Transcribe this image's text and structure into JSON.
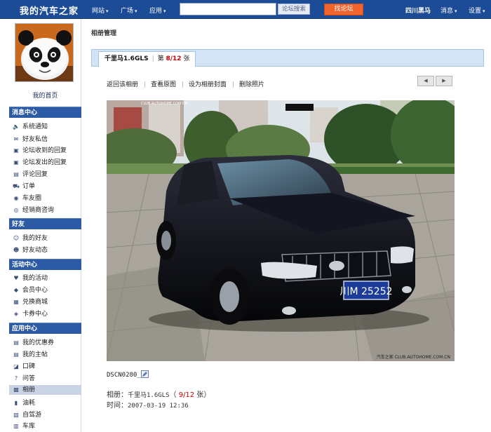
{
  "topbar": {
    "logo": "我的汽车之家",
    "nav": [
      {
        "label": "网站",
        "caret": "▾"
      },
      {
        "label": "广场",
        "caret": "▾"
      },
      {
        "label": "应用",
        "caret": "▾"
      }
    ],
    "search": {
      "value": "",
      "placeholder": ""
    },
    "search_button": "论坛搜索",
    "forum_button": "找论坛",
    "user": "四川黑马",
    "messages": "消息",
    "settings": "设置",
    "caret": "▾",
    "bg": "#1d4c96"
  },
  "sidebar": {
    "home_link": "我的首页",
    "sections": [
      {
        "title": "消息中心",
        "items": [
          {
            "label": "系统通知",
            "icon": "speaker-icon",
            "glyph": "🔈"
          },
          {
            "label": "好友私信",
            "icon": "mail-icon",
            "glyph": "✉"
          },
          {
            "label": "论坛收到的回复",
            "icon": "reply-in-icon",
            "glyph": "▣"
          },
          {
            "label": "论坛发出的回复",
            "icon": "reply-out-icon",
            "glyph": "▣"
          },
          {
            "label": "评论回复",
            "icon": "comment-icon",
            "glyph": "▤"
          },
          {
            "label": "订单",
            "icon": "cart-icon",
            "glyph": "⛟"
          },
          {
            "label": "车友圈",
            "icon": "circle-icon",
            "glyph": "◉"
          },
          {
            "label": "经销商咨询",
            "icon": "consult-icon",
            "glyph": "◎"
          }
        ]
      },
      {
        "title": "好友",
        "items": [
          {
            "label": "我的好友",
            "icon": "friends-icon",
            "glyph": "☺"
          },
          {
            "label": "好友动态",
            "icon": "friend-activity-icon",
            "glyph": "☻"
          }
        ]
      },
      {
        "title": "活动中心",
        "items": [
          {
            "label": "我的活动",
            "icon": "heart-icon",
            "glyph": "♥"
          },
          {
            "label": "会员中心",
            "icon": "member-icon",
            "glyph": "◆"
          },
          {
            "label": "兑换商城",
            "icon": "mall-icon",
            "glyph": "▦"
          },
          {
            "label": "卡券中心",
            "icon": "coupon-icon",
            "glyph": "◈"
          }
        ]
      },
      {
        "title": "应用中心",
        "items": [
          {
            "label": "我的优惠券",
            "icon": "voucher-icon",
            "glyph": "▤"
          },
          {
            "label": "我的主帖",
            "icon": "post-icon",
            "glyph": "▤"
          },
          {
            "label": "口碑",
            "icon": "reputation-icon",
            "glyph": "◪"
          },
          {
            "label": "问答",
            "icon": "qa-icon",
            "glyph": "?"
          },
          {
            "label": "相册",
            "icon": "album-icon",
            "glyph": "▩"
          },
          {
            "label": "油耗",
            "icon": "fuel-icon",
            "glyph": "▮"
          },
          {
            "label": "自驾游",
            "icon": "travel-icon",
            "glyph": "▧"
          },
          {
            "label": "车库",
            "icon": "garage-icon",
            "glyph": "▥"
          }
        ]
      }
    ],
    "active_item": "相册"
  },
  "main": {
    "breadcrumb": "相册管理",
    "tab": {
      "title": "千里马1.6GLS",
      "prefix": "第",
      "page": "8/12",
      "suffix": "张"
    },
    "actions": [
      "返回该相册",
      "查看原图",
      "设为相册封面",
      "删除照片"
    ],
    "prev": "◀",
    "next": "▶",
    "photo": {
      "watermark": "汽车之家 CLUB.AUTOHOME.COM.CN",
      "plate": "川M 25252",
      "top_watermark": "CLUB AUTOHOME COM CN"
    },
    "filename": "DSCN0280_",
    "meta": {
      "album_label": "相册：",
      "album_name": "千里马1.6GLS",
      "count_open": "（",
      "count": "9/12",
      "count_close": "张）",
      "time_label": "时间：",
      "time": "2007-03-19 12:36"
    }
  }
}
